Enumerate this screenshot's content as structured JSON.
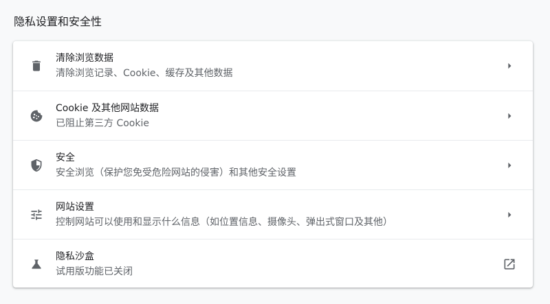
{
  "section": {
    "title": "隐私设置和安全性"
  },
  "rows": [
    {
      "title": "清除浏览数据",
      "subtitle": "清除浏览记录、Cookie、缓存及其他数据",
      "icon": "trash-icon",
      "action_icon": "arrow-right-icon"
    },
    {
      "title": "Cookie 及其他网站数据",
      "subtitle": "已阻止第三方 Cookie",
      "icon": "cookie-icon",
      "action_icon": "arrow-right-icon"
    },
    {
      "title": "安全",
      "subtitle": "安全浏览（保护您免受危险网站的侵害）和其他安全设置",
      "icon": "shield-icon",
      "action_icon": "arrow-right-icon"
    },
    {
      "title": "网站设置",
      "subtitle": "控制网站可以使用和显示什么信息（如位置信息、摄像头、弹出式窗口及其他）",
      "icon": "tune-icon",
      "action_icon": "arrow-right-icon"
    },
    {
      "title": "隐私沙盒",
      "subtitle": "试用版功能已关闭",
      "icon": "flask-icon",
      "action_icon": "open-in-new-icon"
    }
  ],
  "colors": {
    "page_background": "#f8f9fa",
    "card_background": "#ffffff",
    "title_text": "#202124",
    "secondary_text": "#5f6368",
    "icon": "#5f6368",
    "divider": "#e8eaed"
  }
}
